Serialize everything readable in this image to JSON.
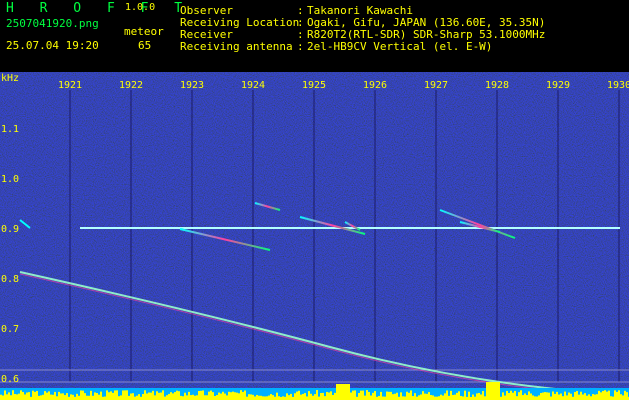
{
  "app": {
    "name": "H R O F F T",
    "version": "1.0.0"
  },
  "file": {
    "name": "2507041920.png",
    "datetime": "25.07.04 19:20"
  },
  "detector": {
    "label": "meteor",
    "count": "65"
  },
  "info": [
    {
      "label": "Observer",
      "value": "Takanori Kawachi"
    },
    {
      "label": "Receiving Location",
      "value": "Ogaki, Gifu, JAPAN (136.60E, 35.35N)"
    },
    {
      "label": "Receiver",
      "value": "R820T2(RTL-SDR) SDR-Sharp 53.1000MHz"
    },
    {
      "label": "Receiving antenna",
      "value": "2el-HB9CV Vertical (el. E-W)"
    }
  ],
  "axis": {
    "y_unit": "kHz",
    "y_ticks": [
      "1.1",
      "1.0",
      "0.9",
      "0.8",
      "0.7",
      "0.6"
    ],
    "x_ticks": [
      "1921",
      "1922",
      "1923",
      "1924",
      "1925",
      "1926",
      "1927",
      "1928",
      "1929",
      "1930"
    ]
  },
  "colors": {
    "background": "#000000",
    "noise": "#000066",
    "text_yellow": "#ffff00",
    "text_green": "#00ff40",
    "signal": "#ffffff",
    "meteor": "#ff40a0"
  }
}
